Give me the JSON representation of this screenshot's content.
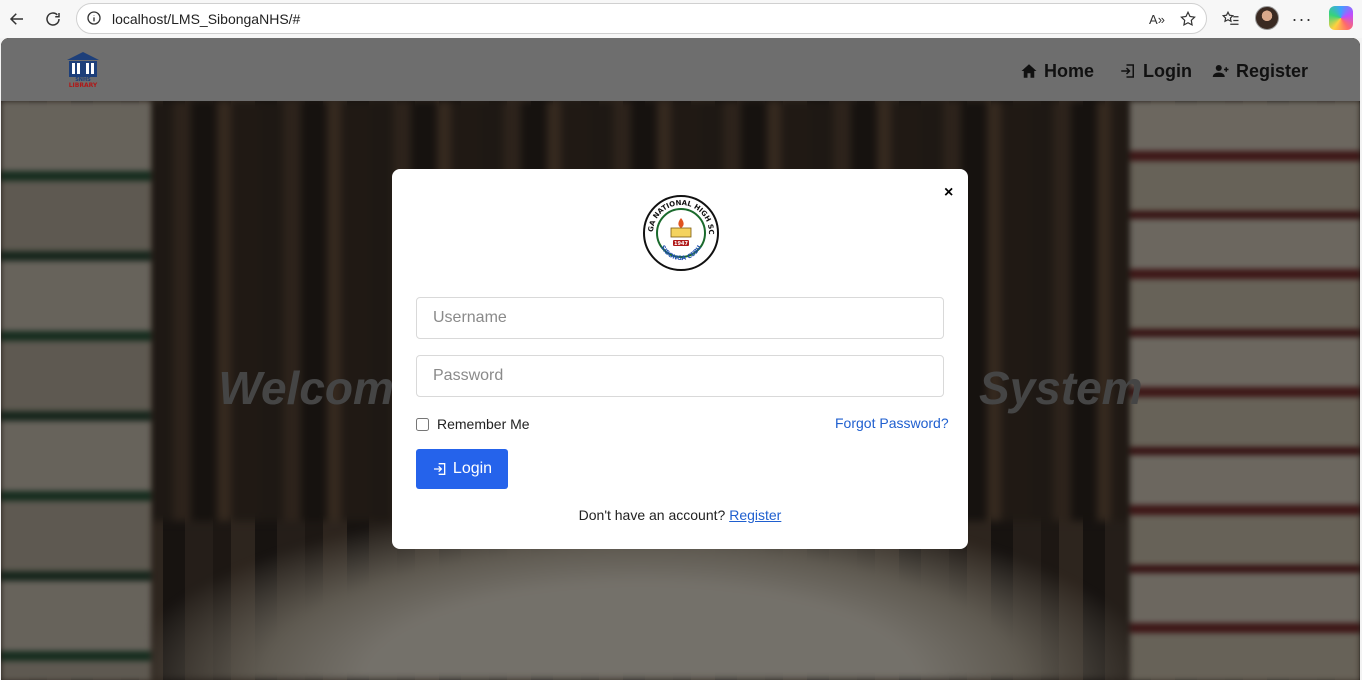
{
  "browser": {
    "url": "localhost/LMS_SibongaNHS/#",
    "read_aloud_label": "A»",
    "icons": [
      "back-icon",
      "refresh-icon",
      "info-icon",
      "read-aloud-icon",
      "favorite-star-icon",
      "favorites-list-icon",
      "profile-avatar",
      "more-menu-icon",
      "copilot-icon"
    ]
  },
  "header": {
    "logo_text_top": "SNHS",
    "logo_text_bottom": "LIBRARY",
    "nav": [
      {
        "label": "Home",
        "icon": "home-icon"
      },
      {
        "label": "Login",
        "icon": "login-icon"
      },
      {
        "label": "Register",
        "icon": "user-plus-icon"
      }
    ]
  },
  "hero": {
    "title_left": "Welcom",
    "title_right": "System"
  },
  "modal": {
    "close_label": "×",
    "seal": {
      "top_text": "SIBONGA NATIONAL HIGH SCHOOL",
      "year": "1947",
      "bottom_text": "SIBONGA CEBU"
    },
    "username_placeholder": "Username",
    "password_placeholder": "Password",
    "remember_label": "Remember Me",
    "forgot_label": "Forgot Password?",
    "login_label": "Login",
    "register_prompt": "Don't have an account?",
    "register_link": "Register"
  },
  "colors": {
    "primary": "#2563eb",
    "link": "#1f5fcf",
    "header_bg": "#6e6e6e"
  }
}
